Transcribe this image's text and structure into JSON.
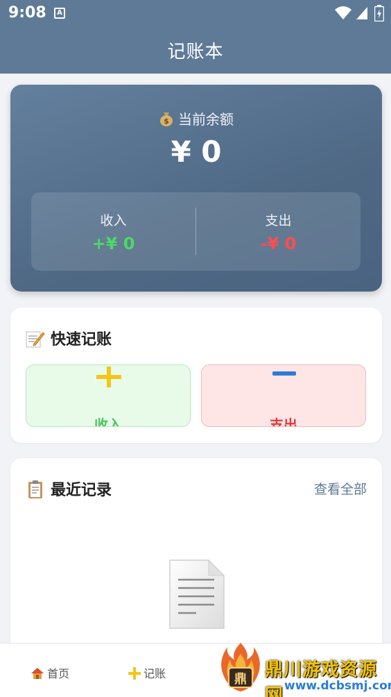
{
  "status_bar": {
    "time": "9:08",
    "notification_icon": "A"
  },
  "header": {
    "title": "记账本"
  },
  "balance": {
    "label": "当前余额",
    "value": "¥ 0",
    "income_label": "收入",
    "income_value": "+¥ 0",
    "expense_label": "支出",
    "expense_value": "-¥ 0"
  },
  "quick": {
    "title": "快速记账",
    "income_label": "收入",
    "expense_label": "支出"
  },
  "recent": {
    "title": "最近记录",
    "view_all": "查看全部"
  },
  "nav": {
    "home": "首页",
    "record": "记账"
  },
  "watermark": {
    "text": "鼎川游戏资源网",
    "url": "www.dcbsmj.com"
  },
  "colors": {
    "header": "#5e7a96",
    "income": "#4cd964",
    "expense": "#ff4d4f",
    "accent": "#5e7a96"
  }
}
